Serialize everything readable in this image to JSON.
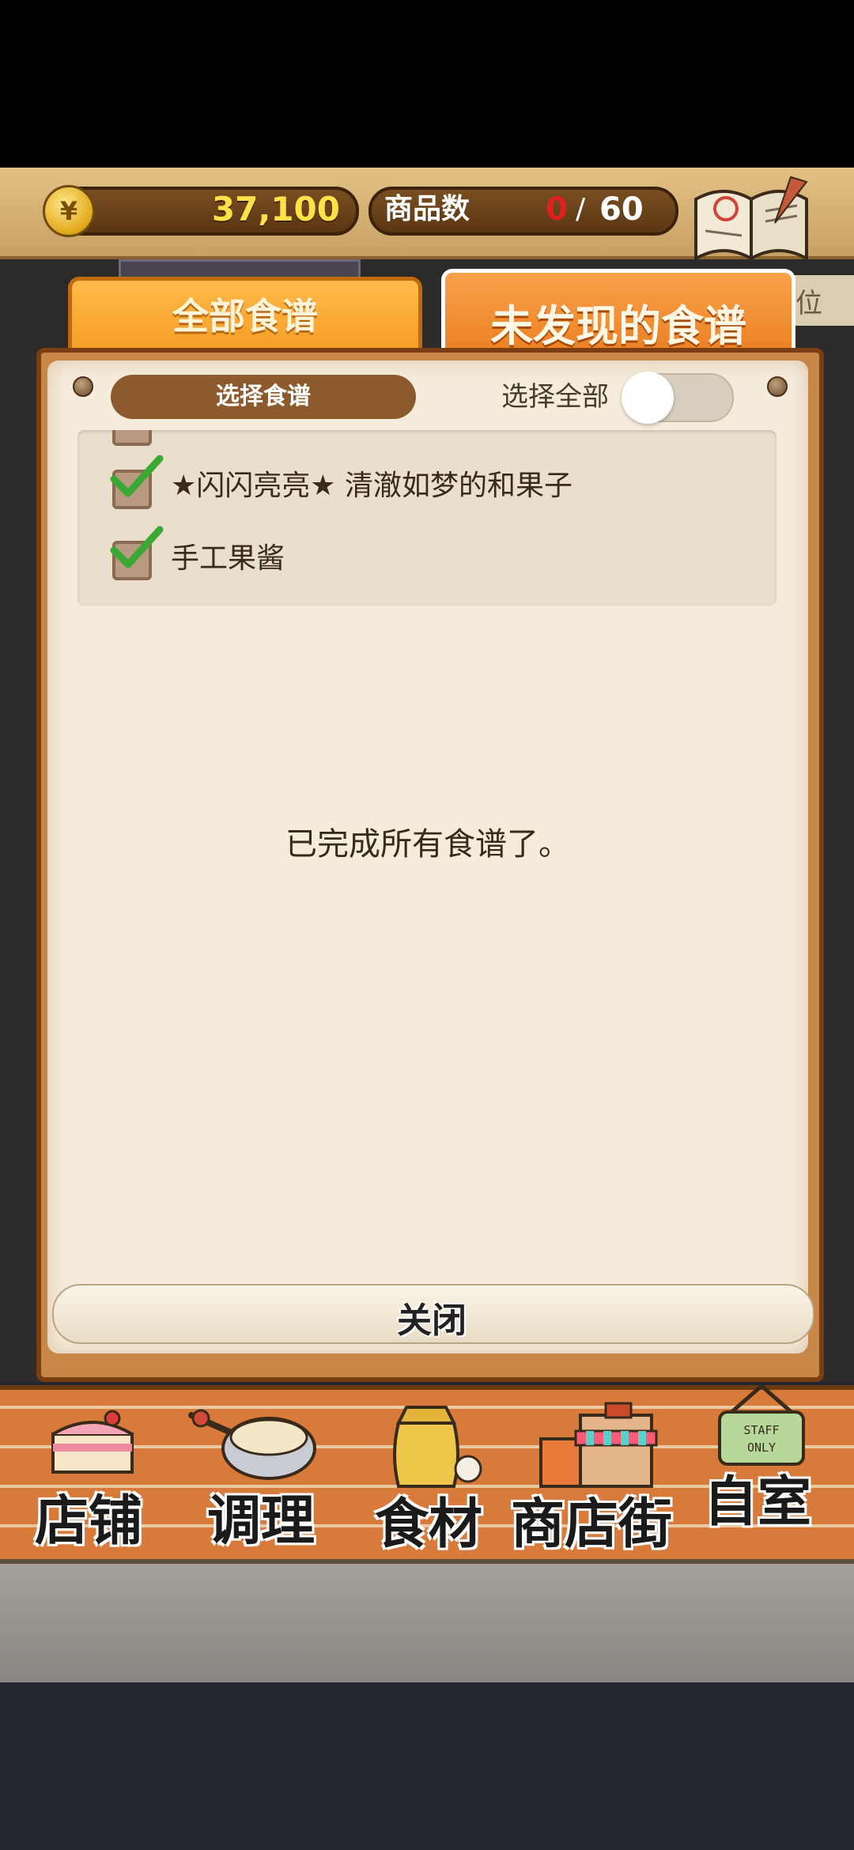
{
  "header": {
    "currency_symbol": "¥",
    "money": "37,100",
    "goods_label": "商品数",
    "goods_current": "0",
    "goods_max": "60",
    "recipe_book_label": "食谱",
    "side_tab_text": "位"
  },
  "tabs": [
    {
      "label": "全部食谱",
      "active": false
    },
    {
      "label": "未发现的食谱",
      "active": true
    }
  ],
  "panel": {
    "select_label": "选择食谱",
    "select_all_label": "选择全部",
    "select_all_on": false,
    "items": [
      {
        "label": "★闪闪亮亮★ 清澈如梦的和果子",
        "checked": true
      },
      {
        "label": "手工果酱",
        "checked": true
      }
    ],
    "empty_message": "已完成所有食谱了。",
    "close_label": "关闭"
  },
  "nav": {
    "items": [
      {
        "label": "店铺",
        "icon": "cake-icon"
      },
      {
        "label": "调理",
        "icon": "mixing-bowl-icon"
      },
      {
        "label": "食材",
        "icon": "flour-sack-icon"
      },
      {
        "label": "商店街",
        "icon": "shop-street-icon"
      },
      {
        "label": "自室",
        "icon": "staff-only-sign-icon",
        "sign_text": "STAFF ONLY"
      }
    ]
  },
  "colors": {
    "accent": "#f39a20",
    "money": "#ffe14a",
    "goods_current": "#e02020",
    "check": "#3aa832"
  }
}
